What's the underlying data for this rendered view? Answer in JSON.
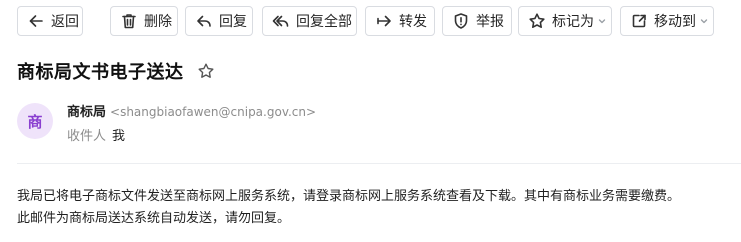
{
  "toolbar": {
    "back": "返回",
    "delete": "删除",
    "reply": "回复",
    "reply_all": "回复全部",
    "forward": "转发",
    "report": "举报",
    "mark_as": "标记为",
    "move_to": "移动到"
  },
  "email": {
    "subject": "商标局文书电子送达",
    "sender": {
      "avatar_text": "商",
      "avatar_color": "#efe3fa",
      "avatar_text_color": "#8a3fd0",
      "name": "商标局",
      "email": "<shangbiaofawen@cnipa.gov.cn>"
    },
    "recipient": {
      "label": "收件人",
      "value": "我"
    },
    "body": {
      "line1": "我局已将电子商标文件发送至商标网上服务系统，请登录商标网上服务系统查看及下载。其中有商标业务需要缴费。",
      "line2": "此邮件为商标局送达系统自动发送，请勿回复。"
    }
  },
  "icons": {
    "back": "arrow-left-icon",
    "delete": "trash-icon",
    "reply": "reply-icon",
    "reply_all": "reply-all-icon",
    "forward": "forward-icon",
    "report": "shield-alert-icon",
    "mark_as": "star-icon",
    "move_to": "move-folder-icon",
    "subject_star": "star-icon"
  }
}
